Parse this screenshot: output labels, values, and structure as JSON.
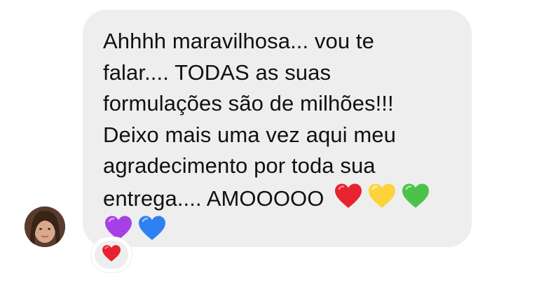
{
  "sender": {
    "avatar_icon": "profile-photo"
  },
  "message": {
    "lines": [
      "Ahhhh maravilhosa... vou te",
      "falar.... TODAS as suas",
      "formulações são de milhões!!!",
      "Deixo mais uma vez aqui meu",
      "agradecimento por toda sua",
      "entrega.... AMOOOOO"
    ],
    "emojis_line6": [
      "red-heart-icon",
      "yellow-heart-icon",
      "green-heart-icon"
    ],
    "emojis_line7": [
      "purple-heart-icon",
      "blue-heart-icon"
    ]
  },
  "reaction": {
    "emoji": "red-heart-icon"
  },
  "colors": {
    "bubble_background": "#eeeeef",
    "text": "#111111",
    "heart_red": "#e8222e",
    "heart_yellow": "#fdd33a",
    "heart_green": "#4cc24a",
    "heart_purple": "#a63fe6",
    "heart_blue": "#2f80f2"
  }
}
